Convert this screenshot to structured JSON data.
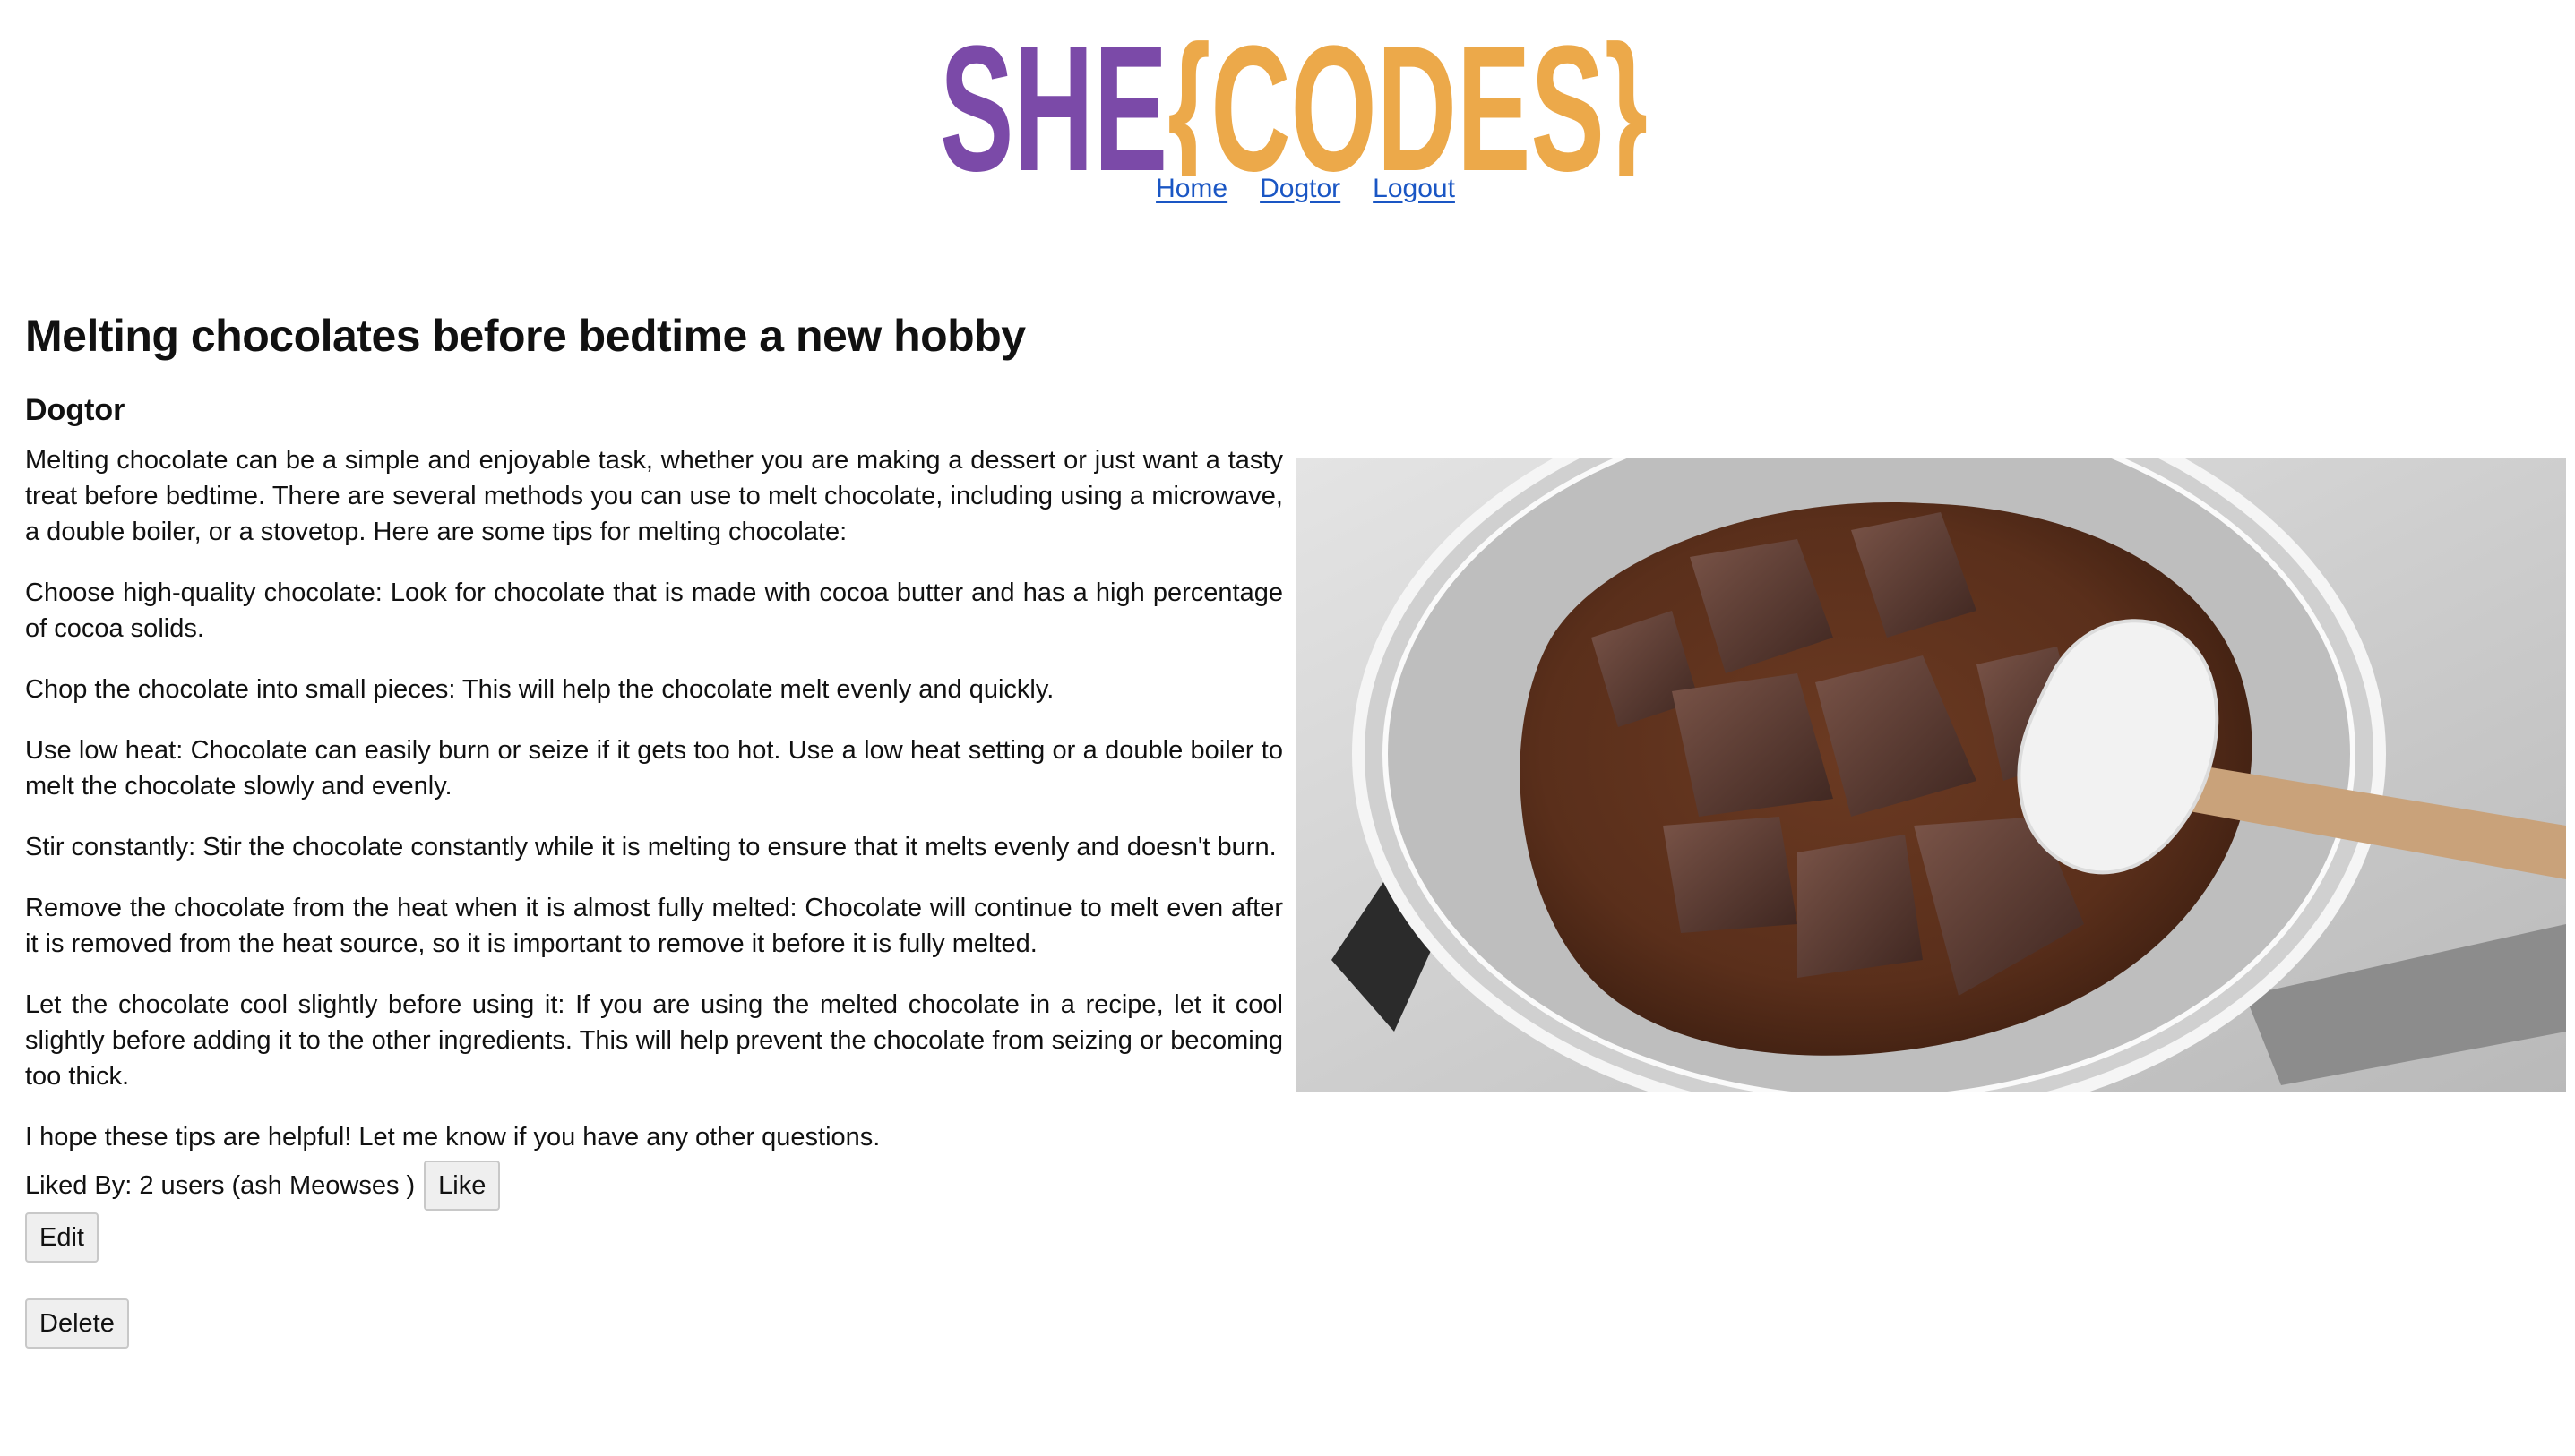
{
  "logo": {
    "text_a": "SHE",
    "text_b": "{CODES}",
    "color_a": "#7b4aa8",
    "color_b": "#eca94a"
  },
  "nav": [
    {
      "label": "Home"
    },
    {
      "label": "Dogtor"
    },
    {
      "label": "Logout"
    }
  ],
  "post": {
    "title": "Melting chocolates before bedtime a new hobby",
    "author": "Dogtor",
    "paragraphs": [
      "Melting chocolate can be a simple and enjoyable task, whether you are making a dessert or just want a tasty treat before bedtime. There are several methods you can use to melt chocolate, including using a microwave, a double boiler, or a stovetop. Here are some tips for melting chocolate:",
      "Choose high-quality chocolate: Look for chocolate that is made with cocoa butter and has a high percentage of cocoa solids.",
      "Chop the chocolate into small pieces: This will help the chocolate melt evenly and quickly.",
      "Use low heat: Chocolate can easily burn or seize if it gets too hot. Use a low heat setting or a double boiler to melt the chocolate slowly and evenly.",
      "Stir constantly: Stir the chocolate constantly while it is melting to ensure that it melts evenly and doesn't burn.",
      "Remove the chocolate from the heat when it is almost fully melted: Chocolate will continue to melt even after it is removed from the heat source, so it is important to remove it before it is fully melted.",
      "Let the chocolate cool slightly before using it: If you are using the melted chocolate in a recipe, let it cool slightly before adding it to the other ingredients. This will help prevent the chocolate from seizing or becoming too thick.",
      "I hope these tips are helpful! Let me know if you have any other questions."
    ],
    "likes_text": "Liked By: 2 users (ash Meowses )",
    "like_label": "Like",
    "edit_label": "Edit",
    "delete_label": "Delete",
    "image_icon": "melted-chocolate-bowl-photo"
  }
}
